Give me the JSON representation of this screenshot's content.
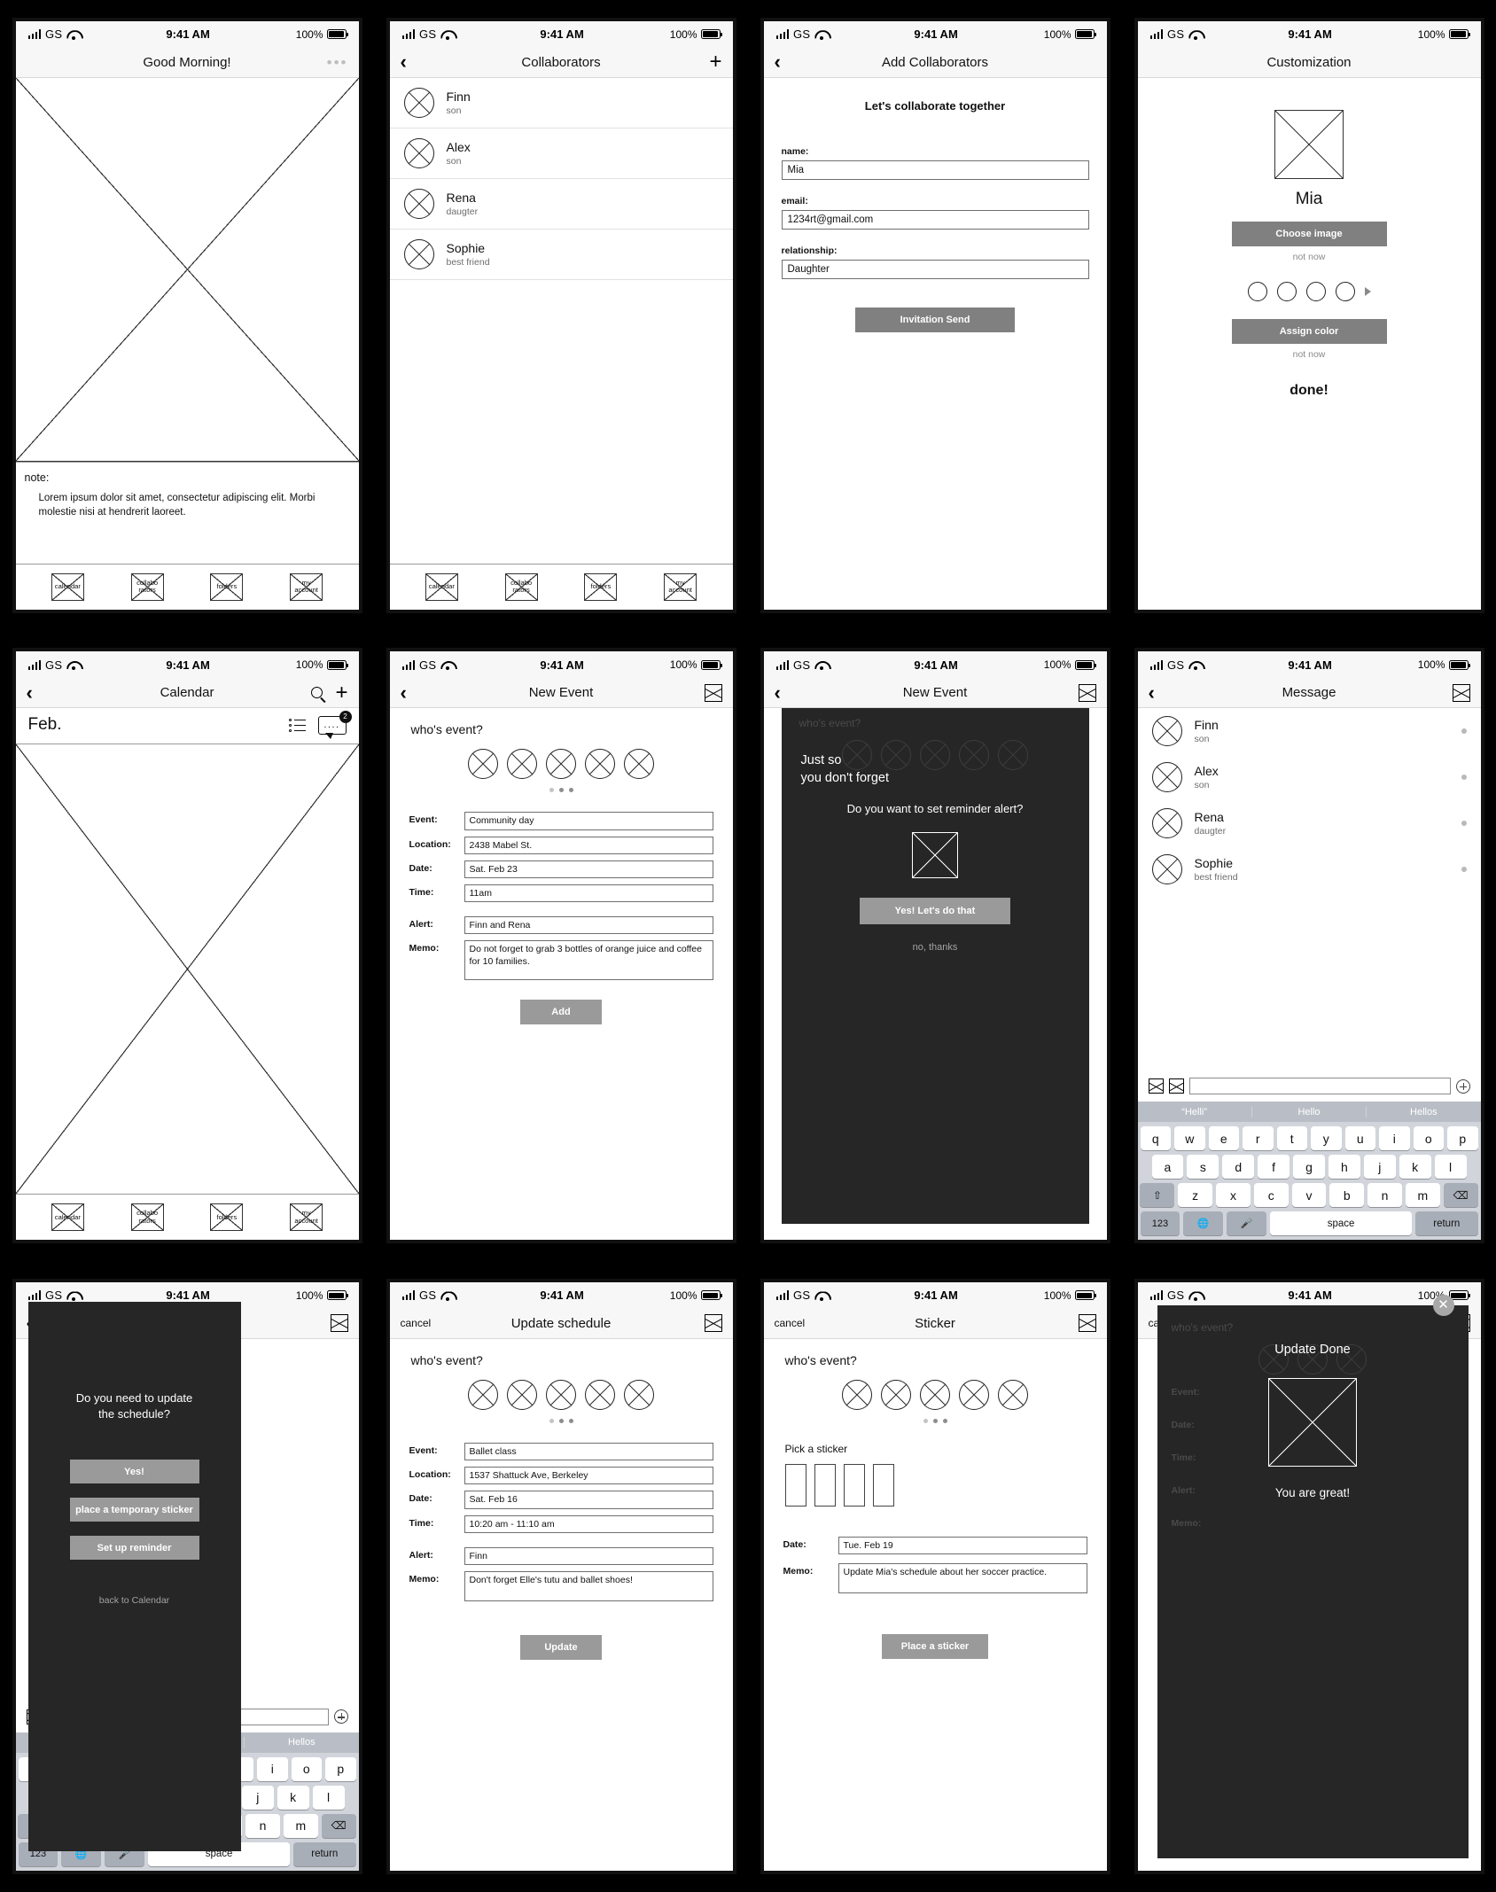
{
  "status_bar": {
    "carrier": "GS",
    "time": "9:41 AM",
    "battery": "100%"
  },
  "tabbar": {
    "items": [
      "calendar",
      "collabo\nrators",
      "folders",
      "my\naccount"
    ]
  },
  "screens": {
    "home": {
      "title": "Good Morning!",
      "menu_icon": "•••",
      "note_label": "note:",
      "note_text": "Lorem ipsum dolor sit amet, consectetur adipiscing elit. Morbi molestie nisi at hendrerit laoreet."
    },
    "collaborators": {
      "title": "Collaborators",
      "add_label": "+",
      "people": [
        {
          "name": "Finn",
          "relation": "son"
        },
        {
          "name": "Alex",
          "relation": "son"
        },
        {
          "name": "Rena",
          "relation": "daugter"
        },
        {
          "name": "Sophie",
          "relation": "best friend"
        }
      ]
    },
    "add_collaborators": {
      "title": "Add Collaborators",
      "heading": "Let's collaborate together",
      "fields": [
        {
          "label": "name:",
          "value": "Mia"
        },
        {
          "label": "email:",
          "value": "1234rt@gmail.com"
        },
        {
          "label": "relationship:",
          "value": "Daughter"
        }
      ],
      "submit": "Invitation Send"
    },
    "customization": {
      "title": "Customization",
      "name": "Mia",
      "choose_image": "Choose image",
      "not_now_1": "not now",
      "assign_color": "Assign color",
      "not_now_2": "not now",
      "done": "done!"
    },
    "calendar": {
      "title": "Calendar",
      "month": "Feb.",
      "badge_count": "2"
    },
    "new_event": {
      "title": "New Event",
      "whos_event": "who's event?",
      "fields": [
        {
          "label": "Event:",
          "value": "Community day"
        },
        {
          "label": "Location:",
          "value": "2438 Mabel St."
        },
        {
          "label": "Date:",
          "value": "Sat. Feb 23"
        },
        {
          "label": "Time:",
          "value": "11am"
        }
      ],
      "fields2": [
        {
          "label": "Alert:",
          "value": "Finn and Rena"
        },
        {
          "label": "Memo:",
          "value": "Do not forget to grab 3 bottles of orange juice and coffee for 10 families."
        }
      ],
      "submit": "Add"
    },
    "reminder_modal": {
      "title": "New Event",
      "whos_event": "who's event?",
      "headline": "Just so\nyou don't forget",
      "question": "Do you want to set reminder alert?",
      "confirm": "Yes! Let's do that",
      "dismiss": "no, thanks"
    },
    "message": {
      "title": "Message",
      "people": [
        {
          "name": "Finn",
          "relation": "son"
        },
        {
          "name": "Alex",
          "relation": "son"
        },
        {
          "name": "Rena",
          "relation": "daugter"
        },
        {
          "name": "Sophie",
          "relation": "best friend"
        }
      ],
      "suggestions": [
        "“Helli”",
        "Hello",
        "Hellos"
      ],
      "keyboard": {
        "row1": [
          "q",
          "w",
          "e",
          "r",
          "t",
          "y",
          "u",
          "i",
          "o",
          "p"
        ],
        "row2": [
          "a",
          "s",
          "d",
          "f",
          "g",
          "h",
          "j",
          "k",
          "l"
        ],
        "row3": [
          "z",
          "x",
          "c",
          "v",
          "b",
          "n",
          "m"
        ],
        "shift": "⇧",
        "backspace": "⌫",
        "numbers": "123",
        "globe": "🌐",
        "mic": "🎤",
        "space": "space",
        "return": "return"
      }
    },
    "update_prompt": {
      "question": "Do you need to update\nthe schedule?",
      "options": [
        "Yes!",
        "place a temporary sticker",
        "Set up reminder"
      ],
      "back": "back to Calendar"
    },
    "update_schedule": {
      "cancel": "cancel",
      "title": "Update schedule",
      "whos_event": "who's event?",
      "fields": [
        {
          "label": "Event:",
          "value": "Ballet class"
        },
        {
          "label": "Location:",
          "value": "1537 Shattuck Ave, Berkeley"
        },
        {
          "label": "Date:",
          "value": "Sat. Feb 16"
        },
        {
          "label": "Time:",
          "value": "10:20 am - 11:10 am"
        }
      ],
      "fields2": [
        {
          "label": "Alert:",
          "value": "Finn"
        },
        {
          "label": "Memo:",
          "value": "Don't forget Elle's tutu and ballet shoes!"
        }
      ],
      "submit": "Update"
    },
    "sticker": {
      "cancel": "cancel",
      "title": "Sticker",
      "whos_event": "who's event?",
      "pick_label": "Pick a sticker",
      "fields": [
        {
          "label": "Date:",
          "value": "Tue. Feb 19"
        },
        {
          "label": "Memo:",
          "value": "Update Mia's schedule about her soccer practice."
        }
      ],
      "submit": "Place a sticker"
    },
    "update_done": {
      "cancel": "can",
      "whos_event": "who's event?",
      "title": "Update Done",
      "labels": [
        "Event:",
        "Date:",
        "Time:",
        "Alert:",
        "Memo:"
      ],
      "message": "You are great!",
      "close_icon": "✕"
    }
  }
}
